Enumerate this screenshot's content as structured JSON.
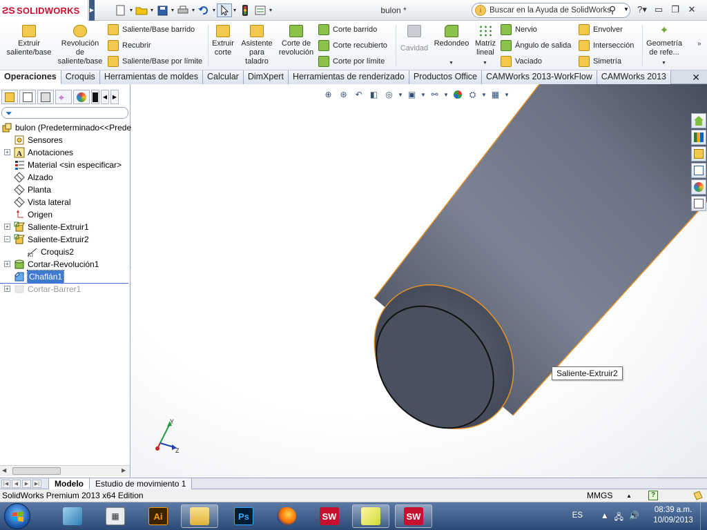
{
  "app": {
    "brand": "SOLIDWORKS",
    "document_title": "bulon *",
    "search_placeholder": "Buscar en la Ayuda de SolidWorks"
  },
  "ribbon": {
    "extruir_saliente": "Extruir saliente/base",
    "revolucion_saliente": "Revolución de saliente/base",
    "saliente_barrido": "Saliente/Base barrido",
    "recubrir": "Recubrir",
    "saliente_limite": "Saliente/Base por límite",
    "extruir_corte": "Extruir corte",
    "asistente_taladro": "Asistente para taladro",
    "corte_revolucion": "Corte de revolución",
    "corte_barrido": "Corte barrido",
    "corte_recubierto": "Corte recubierto",
    "corte_limite": "Corte por límite",
    "cavidad": "Cavidad",
    "redondeo": "Redondeo",
    "matriz_lineal": "Matriz lineal",
    "nervio": "Nervio",
    "angulo_salida": "Ángulo de salida",
    "vaciado": "Vaciado",
    "envolver": "Envolver",
    "interseccion": "Intersección",
    "simetria": "Simetría",
    "geometria_ref": "Geometría de refe..."
  },
  "tabs": [
    {
      "label": "Operaciones",
      "active": true
    },
    {
      "label": "Croquis"
    },
    {
      "label": "Herramientas de moldes"
    },
    {
      "label": "Calcular"
    },
    {
      "label": "DimXpert"
    },
    {
      "label": "Herramientas de renderizado"
    },
    {
      "label": "Productos Office"
    },
    {
      "label": "CAMWorks 2013-WorkFlow"
    },
    {
      "label": "CAMWorks 2013"
    }
  ],
  "tree": {
    "root": "bulon  (Predeterminado<<Predeterminado>)",
    "items": [
      {
        "label": "Sensores",
        "icon": "sensor-icon"
      },
      {
        "label": "Anotaciones",
        "icon": "annotations-icon"
      },
      {
        "label": "Material <sin especificar>",
        "icon": "material-icon"
      },
      {
        "label": "Alzado",
        "icon": "plane-icon"
      },
      {
        "label": "Planta",
        "icon": "plane-icon"
      },
      {
        "label": "Vista lateral",
        "icon": "plane-icon"
      },
      {
        "label": "Origen",
        "icon": "origin-icon"
      },
      {
        "label": "Saliente-Extruir1",
        "icon": "extrude-icon"
      },
      {
        "label": "Saliente-Extruir2",
        "icon": "extrude-icon"
      },
      {
        "label": "Croquis2",
        "icon": "sketch-icon"
      },
      {
        "label": "Cortar-Revolución1",
        "icon": "revolve-cut-icon"
      },
      {
        "label": "Chaflán1",
        "icon": "chamfer-icon",
        "selected": true
      },
      {
        "label": "Cortar-Barrer1",
        "icon": "sweep-cut-icon",
        "suppressed": true
      }
    ]
  },
  "viewport": {
    "tooltip": "Saliente-Extruir2",
    "triad_y": "Y",
    "triad_z": "Z"
  },
  "bottom_tabs": [
    "Modelo",
    "Estudio de movimiento 1"
  ],
  "status": {
    "edition": "SolidWorks Premium 2013 x64 Edition",
    "units": "MMGS"
  },
  "taskbar": {
    "lang": "ES",
    "time": "08:39 a.m.",
    "date": "10/09/2013",
    "ai_label": "Ai",
    "ps_label": "Ps",
    "sw_label": "SW"
  },
  "colors": {
    "accent": "#c8102e",
    "selection": "#3f78d1",
    "edge_highlight": "#e8932a",
    "body": "#6f7685"
  }
}
